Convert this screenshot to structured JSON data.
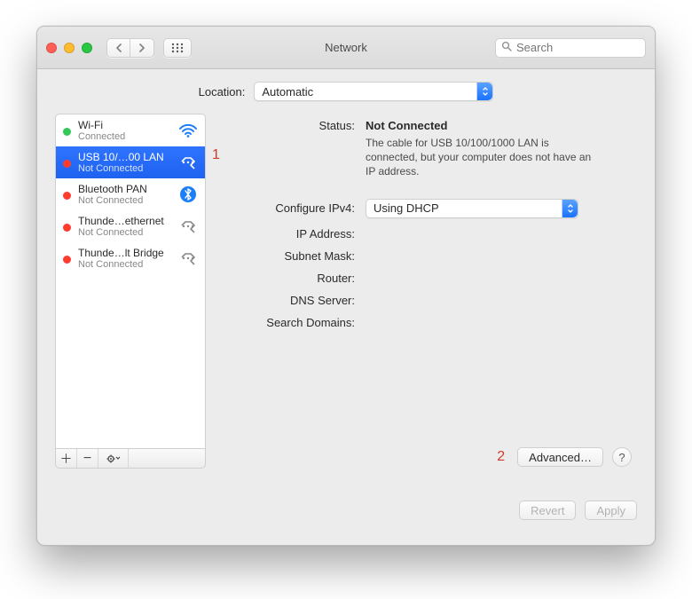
{
  "window": {
    "title": "Network"
  },
  "toolbar": {
    "search_placeholder": "Search"
  },
  "location": {
    "label": "Location:",
    "value": "Automatic"
  },
  "sidebar": {
    "items": [
      {
        "name": "Wi-Fi",
        "status": "Connected",
        "dot": "green",
        "icon": "wifi",
        "selected": false
      },
      {
        "name": "USB 10/…00 LAN",
        "status": "Not Connected",
        "dot": "red",
        "icon": "ethernet",
        "selected": true
      },
      {
        "name": "Bluetooth PAN",
        "status": "Not Connected",
        "dot": "red",
        "icon": "bluetooth",
        "selected": false
      },
      {
        "name": "Thunde…ethernet",
        "status": "Not Connected",
        "dot": "red",
        "icon": "ethernet",
        "selected": false
      },
      {
        "name": "Thunde…lt Bridge",
        "status": "Not Connected",
        "dot": "red",
        "icon": "ethernet",
        "selected": false
      }
    ],
    "toolbar": {
      "add": "+",
      "remove": "−",
      "actions": "✻▾"
    }
  },
  "detail": {
    "status_label": "Status:",
    "status_value": "Not Connected",
    "status_desc": "The cable for USB 10/100/1000 LAN is connected, but your computer does not have an IP address.",
    "configure_label": "Configure IPv4:",
    "configure_value": "Using DHCP",
    "ip_label": "IP Address:",
    "subnet_label": "Subnet Mask:",
    "router_label": "Router:",
    "dns_label": "DNS Server:",
    "search_label": "Search Domains:",
    "advanced": "Advanced…",
    "help": "?"
  },
  "footer": {
    "revert": "Revert",
    "apply": "Apply"
  },
  "annotations": {
    "one": "1",
    "two": "2"
  }
}
